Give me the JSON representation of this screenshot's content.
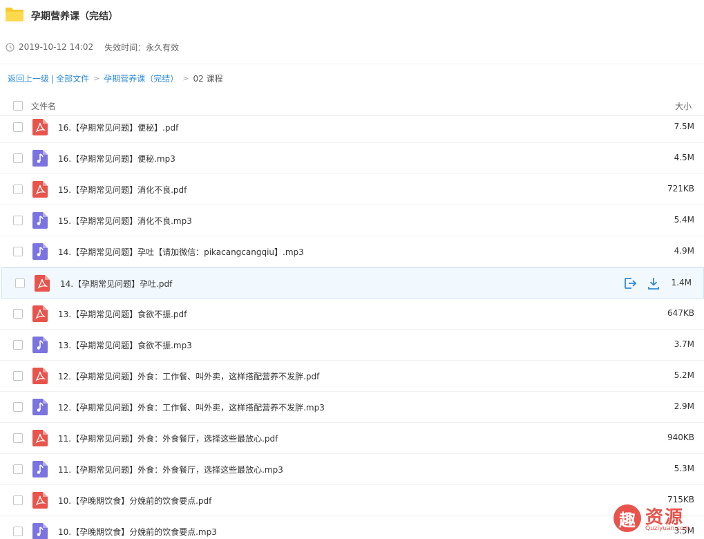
{
  "header": {
    "title": "孕期营养课（完结）",
    "date": "2019-10-12 14:02",
    "expiry": "失效时间：永久有效"
  },
  "breadcrumb": {
    "back": "返回上一级",
    "pipe": "|",
    "all_files": "全部文件",
    "sep": ">",
    "folder": "孕期营养课（完结）",
    "current": "02 课程"
  },
  "columns": {
    "name": "文件名",
    "size": "大小"
  },
  "files": [
    {
      "name": "16.【孕期常见问题】便秘】.pdf",
      "size": "7.5M",
      "type": "pdf"
    },
    {
      "name": "16.【孕期常见问题】便秘.mp3",
      "size": "4.5M",
      "type": "mp3"
    },
    {
      "name": "15.【孕期常见问题】消化不良.pdf",
      "size": "721KB",
      "type": "pdf"
    },
    {
      "name": "15.【孕期常见问题】消化不良.mp3",
      "size": "5.4M",
      "type": "mp3"
    },
    {
      "name": "14.【孕期常见问题】孕吐【请加微信：pikacangcangqiu】.mp3",
      "size": "4.9M",
      "type": "mp3"
    },
    {
      "name": "14.【孕期常见问题】孕吐.pdf",
      "size": "1.4M",
      "type": "pdf"
    },
    {
      "name": "13.【孕期常见问题】食欲不振.pdf",
      "size": "647KB",
      "type": "pdf"
    },
    {
      "name": "13.【孕期常见问题】食欲不振.mp3",
      "size": "3.7M",
      "type": "mp3"
    },
    {
      "name": "12.【孕期常见问题】外食：工作餐、叫外卖，这样搭配营养不发胖.pdf",
      "size": "5.2M",
      "type": "pdf"
    },
    {
      "name": "12.【孕期常见问题】外食：工作餐、叫外卖，这样搭配营养不发胖.mp3",
      "size": "2.9M",
      "type": "mp3"
    },
    {
      "name": "11.【孕期常见问题】外食：外食餐厅，选择这些最放心.pdf",
      "size": "940KB",
      "type": "pdf"
    },
    {
      "name": "11.【孕期常见问题】外食：外食餐厅，选择这些最放心.mp3",
      "size": "5.3M",
      "type": "mp3"
    },
    {
      "name": "10.【孕晚期饮食】分娩前的饮食要点.pdf",
      "size": "715KB",
      "type": "pdf"
    },
    {
      "name": "10.【孕晚期饮食】分娩前的饮食要点.mp3",
      "size": "3.5M",
      "type": "mp3"
    }
  ],
  "hover_row_index": 5,
  "colors": {
    "pdf": "#e8534b",
    "mp3": "#7b73e0",
    "link": "#2e8bd6",
    "folder": "#f9c932",
    "hover_bg": "#f1f8fe"
  },
  "watermark": {
    "glyph": "趣",
    "text": "资源",
    "sub": "Quziyuan.com"
  }
}
